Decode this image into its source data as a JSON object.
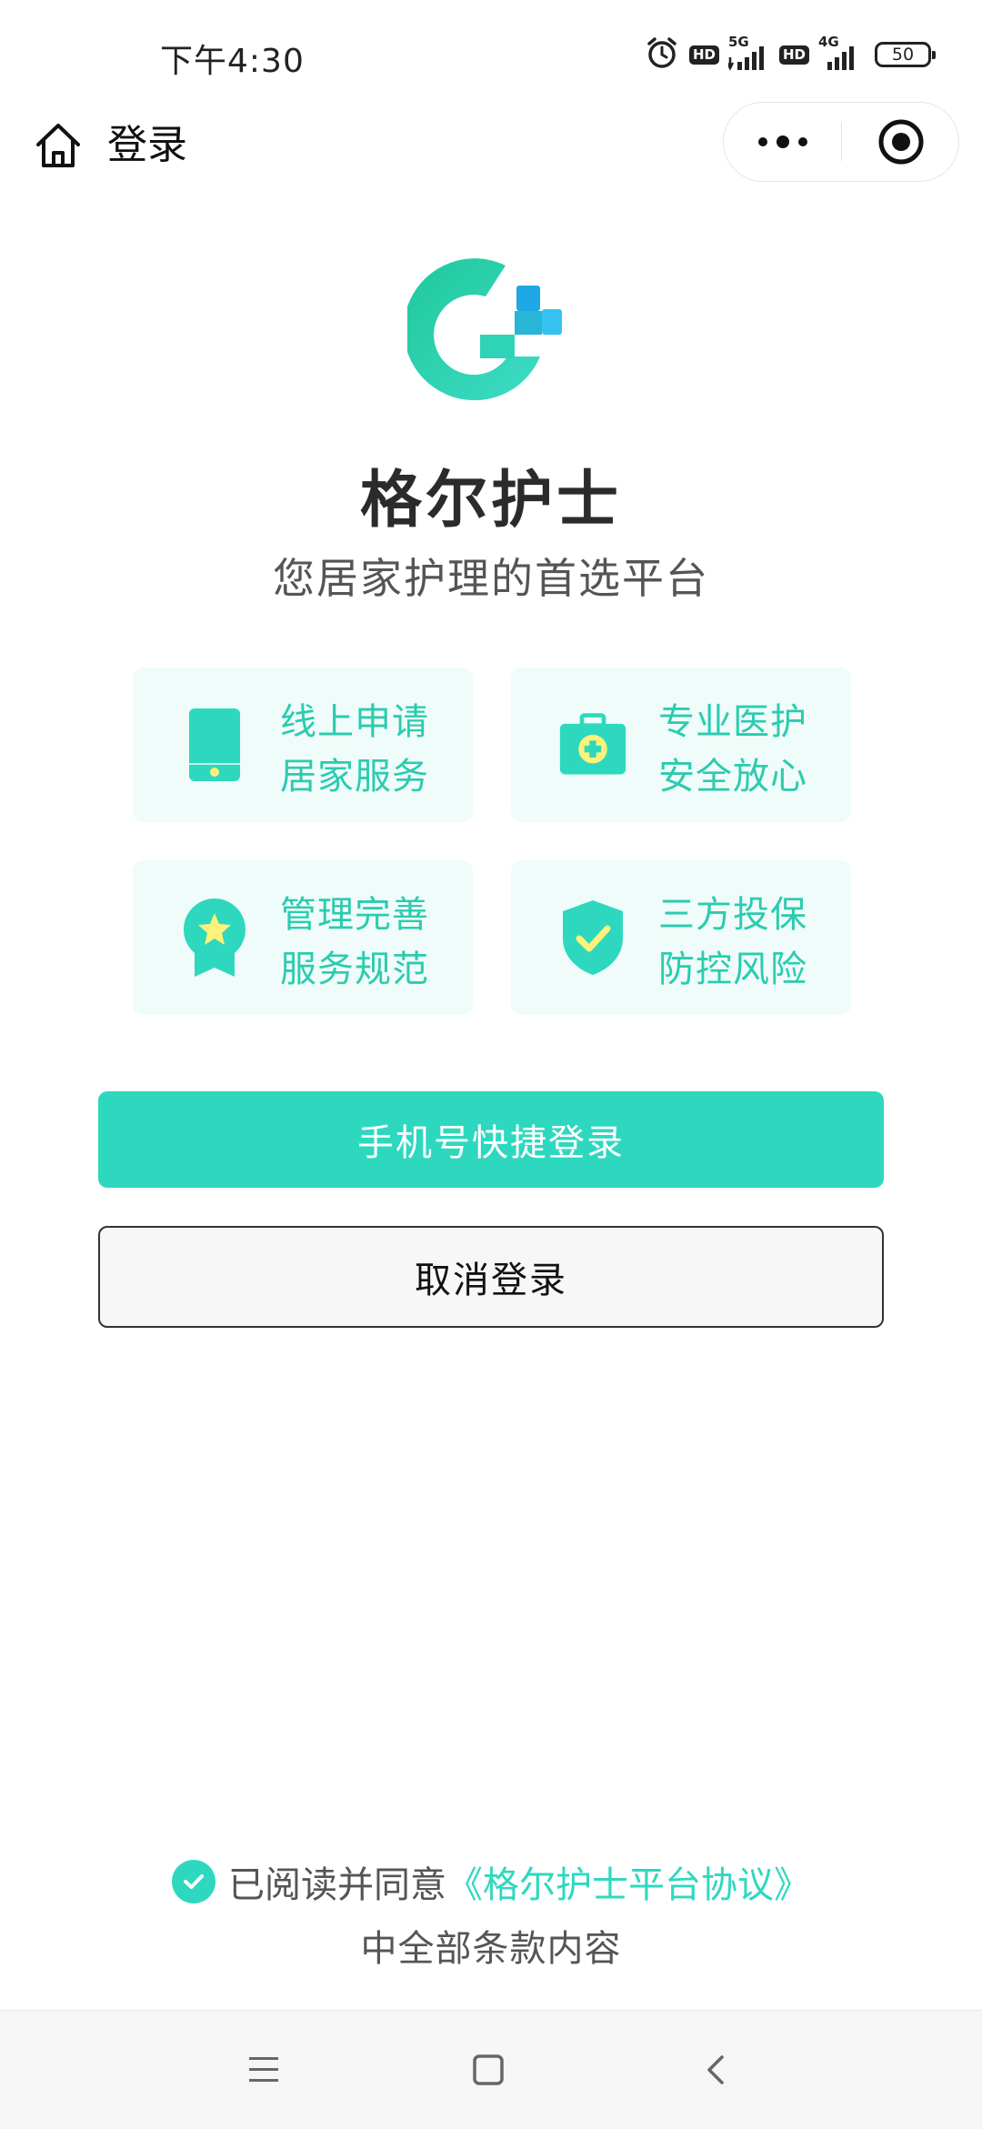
{
  "status_bar": {
    "time": "下午4:30",
    "hd1": "HD",
    "net1": "5G",
    "hd2": "HD",
    "net2": "4G",
    "battery": "50"
  },
  "nav": {
    "title": "登录"
  },
  "app": {
    "title": "格尔护士",
    "subtitle": "您居家护理的首选平台",
    "brand_color": "#2ed8bf",
    "accent_color": "#2ccbb0"
  },
  "features": [
    {
      "icon": "phone-icon",
      "line1": "线上申请",
      "line2": "居家服务"
    },
    {
      "icon": "medical-kit-icon",
      "line1": "专业医护",
      "line2": "安全放心"
    },
    {
      "icon": "award-badge-icon",
      "line1": "管理完善",
      "line2": "服务规范"
    },
    {
      "icon": "shield-check-icon",
      "line1": "三方投保",
      "line2": "防控风险"
    }
  ],
  "buttons": {
    "phone_login": "手机号快捷登录",
    "cancel_login": "取消登录"
  },
  "agreement": {
    "checked": true,
    "prefix": "已阅读并同意",
    "link": "《格尔护士平台协议》",
    "suffix": "中全部条款内容"
  }
}
